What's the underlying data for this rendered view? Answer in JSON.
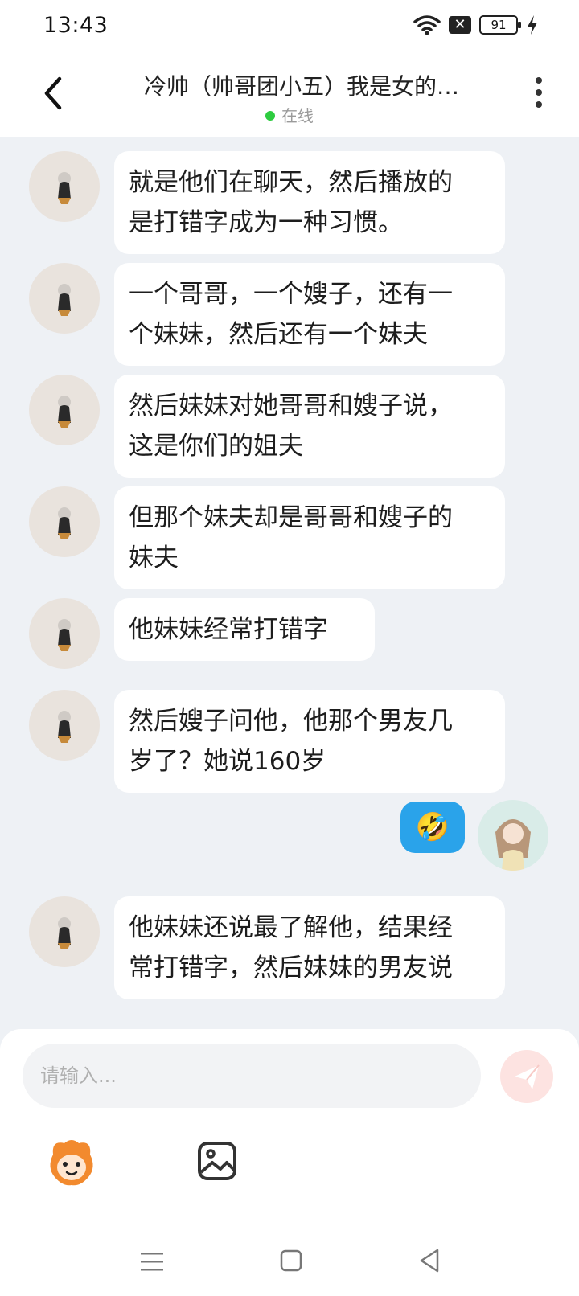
{
  "status_bar": {
    "time": "13:43",
    "battery": "91",
    "icons": [
      "wifi-icon",
      "sim-blocked-icon",
      "battery-icon",
      "charging-icon"
    ]
  },
  "header": {
    "title": "冷帅（帅哥团小五）我是女的…",
    "status": "在线",
    "status_color": "#2ecc40"
  },
  "messages": [
    {
      "from": "other",
      "lines": [
        "就是他们在聊天，然后播放的",
        "是打错字成为一种习惯。"
      ]
    },
    {
      "from": "other",
      "lines": [
        "一个哥哥，一个嫂子，还有一",
        "个妹妹，然后还有一个妹夫"
      ]
    },
    {
      "from": "other",
      "lines": [
        "然后妹妹对她哥哥和嫂子说，",
        "这是你们的姐夫"
      ]
    },
    {
      "from": "other",
      "lines": [
        "但那个妹夫却是哥哥和嫂子的",
        "妹夫"
      ]
    },
    {
      "from": "other",
      "lines": [
        "他妹妹经常打错字"
      ]
    },
    {
      "from": "other",
      "lines": [
        "然后嫂子问他，他那个男友几",
        "岁了？她说160岁"
      ]
    },
    {
      "from": "me",
      "emoji": "🤣"
    },
    {
      "from": "other",
      "lines": [
        "他妹妹还说最了解他，结果经",
        "常打错字，然后妹妹的男友说"
      ]
    }
  ],
  "input": {
    "placeholder": "请输入..."
  },
  "colors": {
    "my_bubble": "#2aa3ea",
    "background": "#eef1f5",
    "send_button": "#fde3e1"
  }
}
